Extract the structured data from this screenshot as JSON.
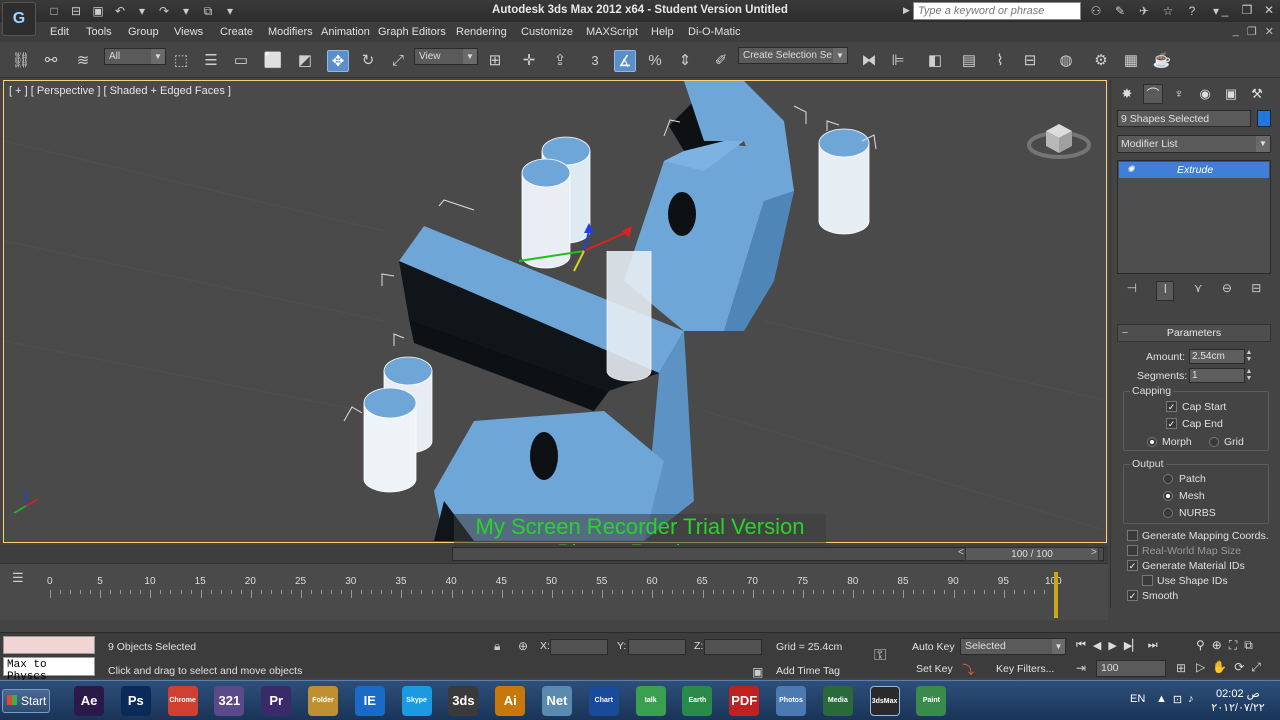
{
  "title_bar": {
    "logo": "G",
    "window_title": "Autodesk 3ds Max  2012 x64  -  Student Version   Untitled",
    "search_placeholder": "Type a keyword or phrase"
  },
  "menu": {
    "items": [
      "Edit",
      "Tools",
      "Group",
      "Views",
      "Create",
      "Modifiers",
      "Animation",
      "Graph Editors",
      "Rendering",
      "Customize",
      "MAXScript",
      "Help",
      "Di-O-Matic"
    ]
  },
  "toolbar": {
    "selection_filter": "All",
    "ref_coord": "View",
    "snap_value": "3",
    "named_selection": "Create Selection Se"
  },
  "viewport": {
    "label": "[ + ] [ Perspective ] [ Shaded + Edged Faces ]"
  },
  "watermark": {
    "line1": "My Screen Recorder Trial Version",
    "line2": "Please Purchase"
  },
  "command_panel": {
    "selection_name": "9 Shapes Selected",
    "object_color": "#1e78e0",
    "modifier_list": "Modifier List",
    "stack_item": "Extrude",
    "parameters_title": "Parameters",
    "amount_label": "Amount:",
    "amount_value": "2.54cm",
    "segments_label": "Segments:",
    "segments_value": "1",
    "capping_title": "Capping",
    "cap_start": "Cap Start",
    "cap_end": "Cap End",
    "morph": "Morph",
    "grid": "Grid",
    "output_title": "Output",
    "patch": "Patch",
    "mesh": "Mesh",
    "nurbs": "NURBS",
    "gen_mapping": "Generate Mapping Coords.",
    "real_world": "Real-World Map Size",
    "gen_material": "Generate Material IDs",
    "use_shape": "Use Shape IDs",
    "smooth": "Smooth"
  },
  "time_slider": {
    "frame_display": "100 / 100",
    "ruler_ticks": [
      "0",
      "5",
      "10",
      "15",
      "20",
      "25",
      "30",
      "35",
      "40",
      "45",
      "50",
      "55",
      "60",
      "65",
      "70",
      "75",
      "80",
      "85",
      "90",
      "95",
      "100"
    ]
  },
  "status": {
    "maxscript_text": "Max to Physcs",
    "selected_count": "9 Objects Selected",
    "prompt": "Click and drag to select and move objects",
    "x_label": "X:",
    "y_label": "Y:",
    "z_label": "Z:",
    "grid": "Grid = 25.4cm",
    "add_time_tag": "Add Time Tag",
    "auto_key": "Auto Key",
    "auto_key_mode": "Selected",
    "set_key": "Set Key",
    "key_filters": "Key Filters...",
    "current_frame": "100"
  },
  "taskbar": {
    "start_label": "Start",
    "apps": [
      "Ae",
      "Ps",
      "Chrome",
      "321",
      "Pr",
      "Folder",
      "IE",
      "Skype",
      "3ds",
      "Ai",
      "Net",
      "Chart",
      "talk",
      "Earth",
      "PDF",
      "Photos",
      "Media",
      "3dsMax",
      "Paint"
    ],
    "lang": "EN",
    "time": "02:02 ص",
    "date": "٢٠١٢/٠٧/٢٢"
  }
}
